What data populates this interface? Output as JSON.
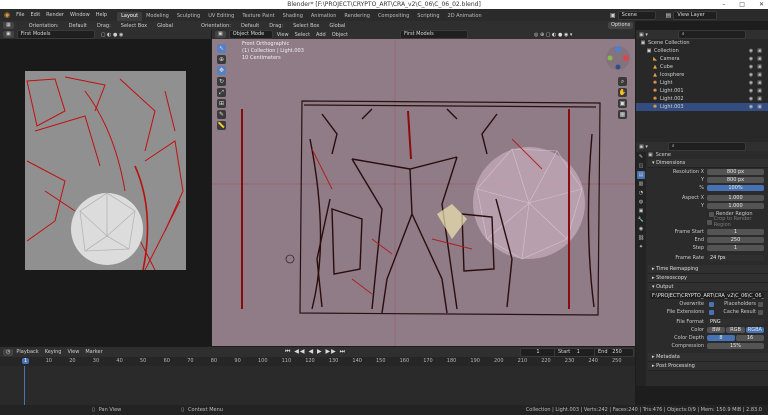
{
  "title": "Blender* [F:\\PROJECT\\CRYPTO_ART\\CRA_v2\\C_06\\C_06_02.blend]",
  "menu": [
    "File",
    "Edit",
    "Render",
    "Window",
    "Help"
  ],
  "workspaces": [
    "Layout",
    "Modeling",
    "Sculpting",
    "UV Editing",
    "Texture Paint",
    "Shading",
    "Animation",
    "Rendering",
    "Compositing",
    "Scripting",
    "2D Animation"
  ],
  "scene": {
    "name": "Scene",
    "view_layer": "View Layer"
  },
  "tool_header": {
    "left": {
      "orientation_label": "Orientation:",
      "orientation_value": "Default",
      "drag_label": "Drag:",
      "drag_value": "Select Box"
    },
    "mid": {
      "global": "Global",
      "orientation_label": "Orientation:",
      "orientation_value": "Default",
      "drag_label": "Drag:",
      "drag_value": "Select Box",
      "global2": "Global"
    },
    "options": "Options"
  },
  "left_header": {
    "mode": "First Models"
  },
  "viewport_header": {
    "mode": "Object Mode",
    "menus": [
      "View",
      "Select",
      "Add",
      "Object"
    ],
    "layer": "First Models"
  },
  "viewport_overlay": {
    "line1": "Front Orthographic",
    "line2": "(1) Collection | Light.003",
    "line3": "10 Centimeters"
  },
  "outliner": {
    "title": "Scene Collection",
    "rows": [
      {
        "label": "Collection",
        "icon": "collection-icon",
        "indent": 1
      },
      {
        "label": "Camera",
        "icon": "camera-icon",
        "indent": 2
      },
      {
        "label": "Cube",
        "icon": "mesh-icon",
        "indent": 2
      },
      {
        "label": "Icosphere",
        "icon": "mesh-icon",
        "indent": 2
      },
      {
        "label": "Light",
        "icon": "light-icon",
        "indent": 2
      },
      {
        "label": "Light.001",
        "icon": "light-icon",
        "indent": 2
      },
      {
        "label": "Light.002",
        "icon": "light-icon",
        "indent": 2
      },
      {
        "label": "Light.003",
        "icon": "light-icon",
        "indent": 2,
        "selected": true
      }
    ]
  },
  "properties": {
    "scene_label": "Scene",
    "dimensions": {
      "title": "Dimensions",
      "resolution_x_label": "Resolution X",
      "resolution_x": "800 px",
      "y_label": "Y",
      "resolution_y": "800 px",
      "percent_label": "%",
      "percent": "100%",
      "aspect_x_label": "Aspect X",
      "aspect_x": "1.000",
      "aspect_y_label": "Y",
      "aspect_y": "1.000",
      "render_region": "Render Region",
      "crop": "Crop to Render Region",
      "frame_start_label": "Frame Start",
      "frame_start": "1",
      "end_label": "End",
      "frame_end": "250",
      "step_label": "Step",
      "step": "1",
      "frame_rate_label": "Frame Rate",
      "frame_rate": "24 fps"
    },
    "time_remapping": "Time Remapping",
    "stereoscopy": "Stereoscopy",
    "output": {
      "title": "Output",
      "path": "F:\\PROJECT\\CRYPTO_ART\\CRA_v2\\C_06\\C_06_02\\C...",
      "overwrite": "Overwrite",
      "placeholders": "Placeholders",
      "file_extensions": "File Extensions",
      "cache_result": "Cache Result",
      "file_format_label": "File Format",
      "file_format": "PNG",
      "color_label": "Color",
      "color_opts": [
        "BW",
        "RGB",
        "RGBA"
      ],
      "color_depth_label": "Color Depth",
      "depth_opts": [
        "8",
        "16"
      ],
      "compression_label": "Compression",
      "compression": "15%"
    },
    "metadata": "Metadata",
    "post_processing": "Post Processing"
  },
  "timeline": {
    "menus": [
      "Playback",
      "Keying",
      "View",
      "Marker"
    ],
    "current_frame": "1",
    "start_label": "Start",
    "start": "1",
    "end_label": "End",
    "end": "250",
    "ticks": [
      "1",
      "10",
      "20",
      "30",
      "40",
      "50",
      "60",
      "70",
      "80",
      "90",
      "100",
      "110",
      "120",
      "130",
      "140",
      "150",
      "160",
      "170",
      "180",
      "190",
      "200",
      "210",
      "220",
      "230",
      "240",
      "250"
    ]
  },
  "statusbar": {
    "left1": "Pan View",
    "left2": "Context Menu",
    "right": "Collection | Light.003 | Verts:242 | Faces:240 | Tris:476 | Objects:0/9 | Mem: 150.9 MiB | 2.83.0"
  },
  "colors": {
    "accent": "#4772b3",
    "viewport_bg": "#8e7b86",
    "sketch": "#c01010"
  }
}
